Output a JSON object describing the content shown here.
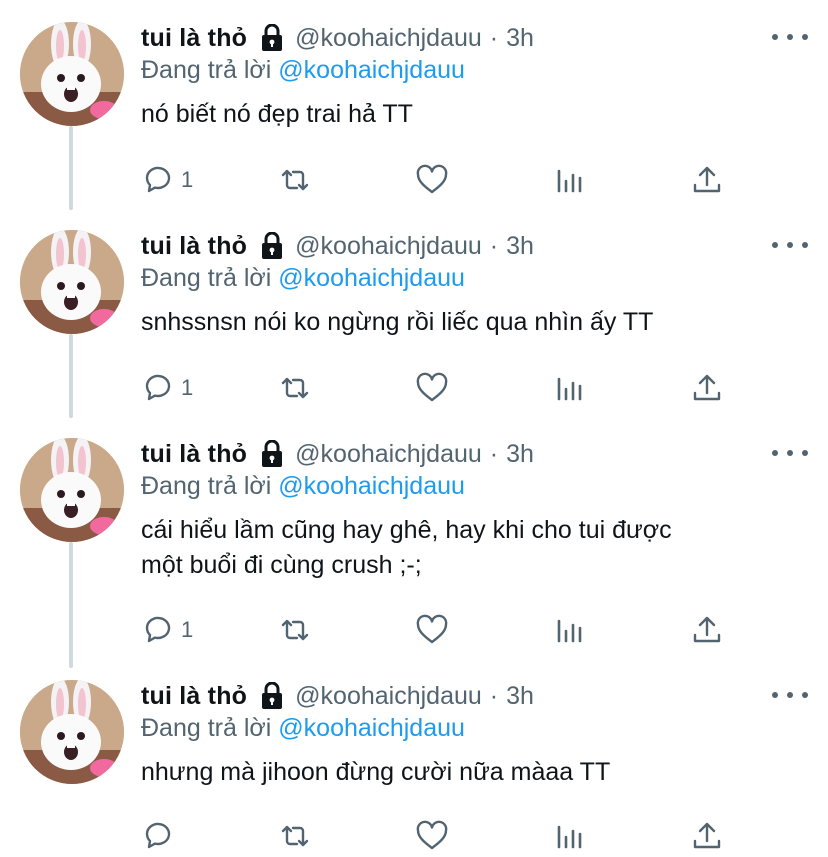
{
  "colors": {
    "accent": "#1d9bf0",
    "secondary_text": "#536471",
    "primary_text": "#0f1419",
    "thread_line": "#cfd9de"
  },
  "icons": {
    "lock": "lock-icon",
    "reply": "reply-icon",
    "retweet": "retweet-icon",
    "like": "heart-icon",
    "views": "views-icon",
    "share": "share-icon",
    "more": "more-icon"
  },
  "tweets": [
    {
      "name": "tui là thỏ",
      "handle": "@koohaichjdauu",
      "separator": "·",
      "time": "3h",
      "reply_prefix": "Đang trả lời",
      "reply_to": "@koohaichjdauu",
      "text": "nó biết nó đẹp trai hả TT",
      "reply_count": "1"
    },
    {
      "name": "tui là thỏ",
      "handle": "@koohaichjdauu",
      "separator": "·",
      "time": "3h",
      "reply_prefix": "Đang trả lời",
      "reply_to": "@koohaichjdauu",
      "text": "snhssnsn nói ko ngừng rồi liếc qua nhìn ấy TT",
      "reply_count": "1"
    },
    {
      "name": "tui là thỏ",
      "handle": "@koohaichjdauu",
      "separator": "·",
      "time": "3h",
      "reply_prefix": "Đang trả lời",
      "reply_to": "@koohaichjdauu",
      "text": "cái hiểu lầm cũng hay ghê, hay khi cho tui được\nmột buổi đi cùng crush ;-;",
      "reply_count": "1"
    },
    {
      "name": "tui là thỏ",
      "handle": "@koohaichjdauu",
      "separator": "·",
      "time": "3h",
      "reply_prefix": "Đang trả lời",
      "reply_to": "@koohaichjdauu",
      "text": "nhưng mà jihoon đừng cười nữa màaa TT",
      "reply_count": ""
    }
  ]
}
